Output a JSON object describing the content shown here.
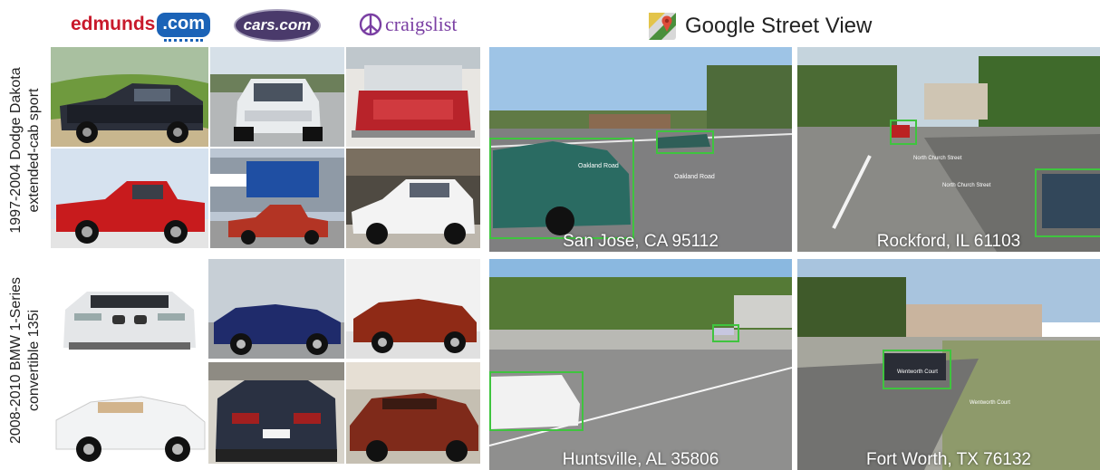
{
  "logos": {
    "edmunds_left": "edmunds",
    "edmunds_right": ".com",
    "cars": "cars.com",
    "craigslist": "craigslist"
  },
  "street_view_title": "Google Street View",
  "rows": [
    {
      "model_line1": "1997-2004 Dodge Dakota",
      "model_line2": "extended-cab sport"
    },
    {
      "model_line1": "2008-2010 BMW 1-Series",
      "model_line2": "convertible 135i"
    }
  ],
  "street_views": [
    {
      "city": "San Jose, CA 95112",
      "street_labels": [
        "Oakland Road",
        "Oakland Road"
      ]
    },
    {
      "city": "Rockford, IL 61103",
      "street_labels": [
        "North Church Street",
        "North Church Street"
      ]
    },
    {
      "city": "Huntsville, AL 35806",
      "street_labels": []
    },
    {
      "city": "Fort Worth, TX 76132",
      "street_labels": [
        "Wentworth Court",
        "Wentworth Court"
      ]
    }
  ],
  "colors": {
    "detection_box": "#3fc43f",
    "dodge_red": "#c0181d",
    "bmw_blue": "#1d2a66",
    "bmw_red": "#8e2a18"
  }
}
